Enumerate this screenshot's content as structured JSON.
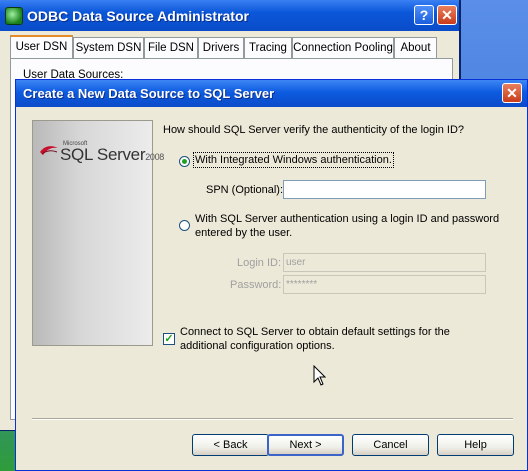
{
  "odbc_window": {
    "title": "ODBC Data Source Administrator",
    "help_glyph": "?",
    "close_glyph": "✕",
    "tabs": [
      "User DSN",
      "System DSN",
      "File DSN",
      "Drivers",
      "Tracing",
      "Connection Pooling",
      "About"
    ],
    "active_tab": "User DSN",
    "panel_label": "User Data Sources:"
  },
  "dialog": {
    "title": "Create a New Data Source to SQL Server",
    "close_glyph": "✕",
    "logo": {
      "brand": "Microsoft",
      "product": "SQL Server",
      "year": "2008"
    },
    "question": "How should SQL Server verify the authenticity of the login ID?",
    "auth_options": {
      "integrated": {
        "label": "With Integrated Windows authentication.",
        "checked": true
      },
      "sql": {
        "label_line1": "With SQL Server authentication using a login ID and password",
        "label_line2": "entered by the user.",
        "checked": false
      }
    },
    "spn": {
      "label": "SPN (Optional):",
      "value": ""
    },
    "login_id": {
      "label": "Login ID:",
      "value": "user"
    },
    "password": {
      "label": "Password:",
      "value": "********"
    },
    "connect_option": {
      "label_line1": "Connect to SQL Server to obtain default settings for the",
      "label_line2": "additional configuration options.",
      "checked": true,
      "check_glyph": "✓"
    },
    "buttons": {
      "back": "< Back",
      "next": "Next >",
      "cancel": "Cancel",
      "help": "Help"
    }
  },
  "colors": {
    "titlebar_blue": "#0a4cc9",
    "dialog_bg": "#ece9d8",
    "radio_dot": "#21a121",
    "close_red": "#c93c1b"
  }
}
